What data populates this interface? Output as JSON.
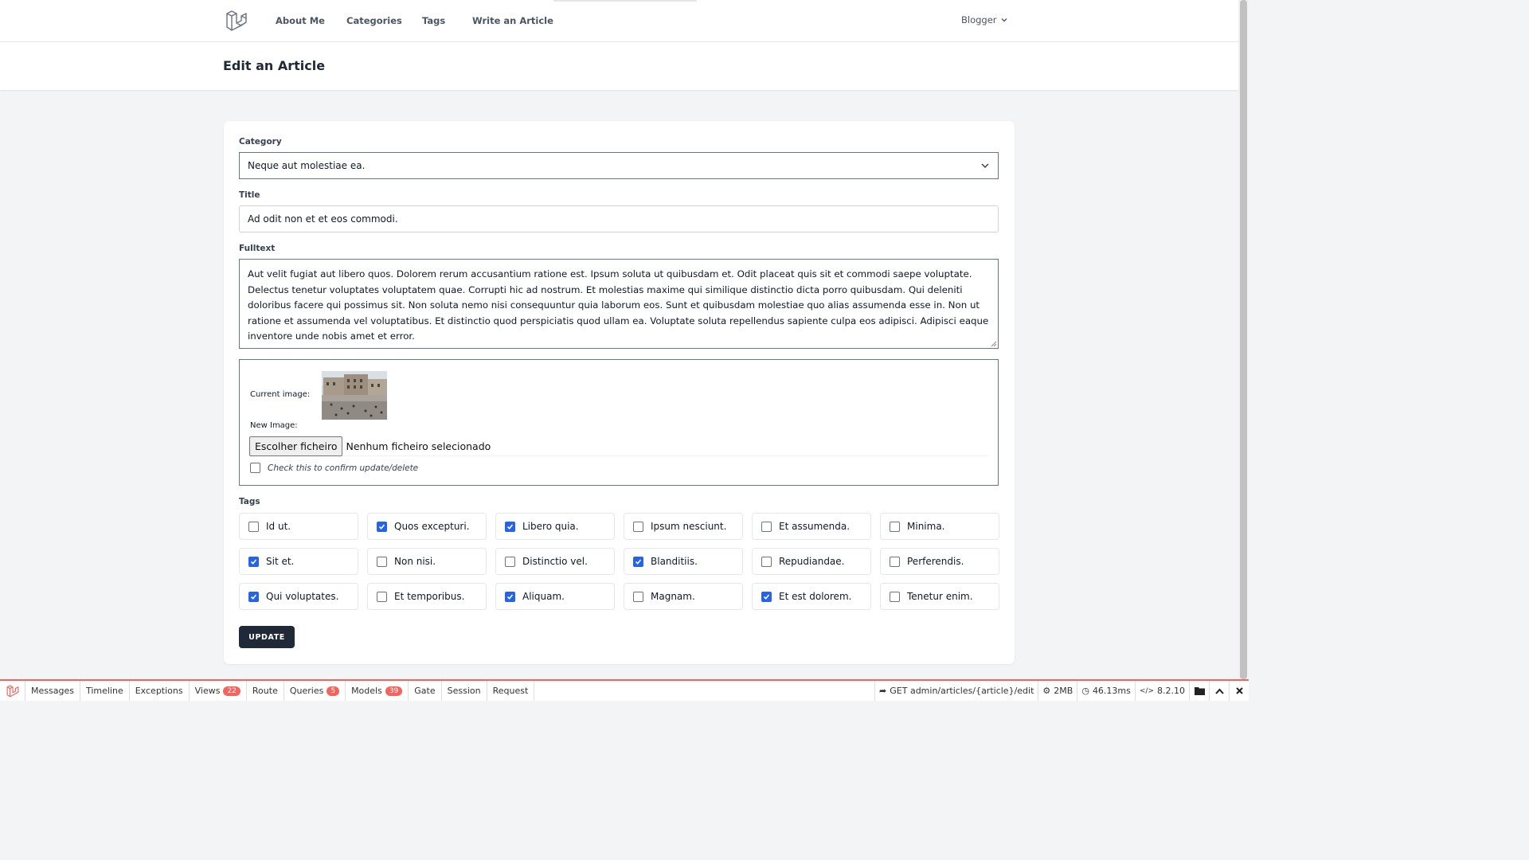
{
  "nav": {
    "links": [
      "About Me",
      "Categories",
      "Tags",
      "Write an Article"
    ],
    "user": "Blogger"
  },
  "page": {
    "title": "Edit an Article"
  },
  "form": {
    "category_label": "Category",
    "category_value": "Neque aut molestiae ea.",
    "title_label": "Title",
    "title_value": "Ad odit non et et eos commodi.",
    "fulltext_label": "Fulltext",
    "fulltext_value": "Aut velit fugiat aut libero quos. Dolorem rerum accusantium ratione est. Ipsum soluta ut quibusdam et. Odit placeat quis sit et commodi saepe voluptate. Delectus tenetur voluptates voluptatem quae. Corrupti hic ad nostrum. Et molestias maxime qui similique distinctio dicta porro quibusdam. Qui deleniti doloribus facere qui possimus sit. Non soluta nemo nisi consequuntur quia laborum eos. Sunt et quibusdam molestiae quo alias assumenda esse in. Non ut ratione et assumenda vel voluptatibus. Et distinctio quod perspiciatis quod ullam ea. Voluptate soluta repellendus sapiente culpa eos adipisci. Adipisci eaque inventore unde nobis amet et error.",
    "current_image_label": "Current image:",
    "new_image_label": "New Image:",
    "file_button": "Escolher ficheiro",
    "file_status": "Nenhum ficheiro selecionado",
    "confirm_label": "Check this to confirm update/delete",
    "tags_label": "Tags",
    "tags": [
      {
        "label": "Id ut.",
        "checked": false
      },
      {
        "label": "Quos excepturi.",
        "checked": true
      },
      {
        "label": "Libero quia.",
        "checked": true
      },
      {
        "label": "Ipsum nesciunt.",
        "checked": false
      },
      {
        "label": "Et assumenda.",
        "checked": false
      },
      {
        "label": "Minima.",
        "checked": false
      },
      {
        "label": "Sit et.",
        "checked": true
      },
      {
        "label": "Non nisi.",
        "checked": false
      },
      {
        "label": "Distinctio vel.",
        "checked": false
      },
      {
        "label": "Blanditiis.",
        "checked": true
      },
      {
        "label": "Repudiandae.",
        "checked": false
      },
      {
        "label": "Perferendis.",
        "checked": false
      },
      {
        "label": "Qui voluptates.",
        "checked": true
      },
      {
        "label": "Et temporibus.",
        "checked": false
      },
      {
        "label": "Aliquam.",
        "checked": true
      },
      {
        "label": "Magnam.",
        "checked": false
      },
      {
        "label": "Et est dolorem.",
        "checked": true
      },
      {
        "label": "Tenetur enim.",
        "checked": false
      }
    ],
    "submit_label": "UPDATE"
  },
  "debugbar": {
    "tabs": [
      {
        "label": "Messages",
        "badge": null
      },
      {
        "label": "Timeline",
        "badge": null
      },
      {
        "label": "Exceptions",
        "badge": null
      },
      {
        "label": "Views",
        "badge": "22"
      },
      {
        "label": "Route",
        "badge": null
      },
      {
        "label": "Queries",
        "badge": "5"
      },
      {
        "label": "Models",
        "badge": "39"
      },
      {
        "label": "Gate",
        "badge": null
      },
      {
        "label": "Session",
        "badge": null
      },
      {
        "label": "Request",
        "badge": null
      }
    ],
    "route": "GET admin/articles/{article}/edit",
    "memory": "2MB",
    "time": "46.13ms",
    "php_version": "8.2.10"
  },
  "colors": {
    "accent": "#2563eb",
    "button_dark": "#1f2937",
    "debugbar_red": "#f4645f"
  }
}
